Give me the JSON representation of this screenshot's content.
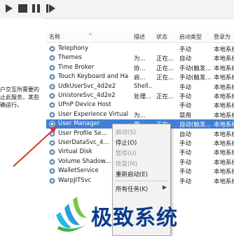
{
  "toolbar": {
    "buttons": [
      {
        "name": "start-icon"
      },
      {
        "name": "stop-icon"
      },
      {
        "name": "pause-icon"
      },
      {
        "name": "resume-icon"
      }
    ]
  },
  "left_pane": {
    "description_lines": [
      "户交互所需要的",
      "止此服务，某些",
      "确运行。"
    ]
  },
  "columns": {
    "name": "名称",
    "description": "描述",
    "status": "状态",
    "startup_type": "启动类型",
    "logon_as": "登录为"
  },
  "services": [
    {
      "name": "Telephony",
      "description": "",
      "status": "",
      "startup": "手动",
      "logon": "本地系统"
    },
    {
      "name": "Themes",
      "description": "为...",
      "status": "正在...",
      "startup": "自动",
      "logon": "本地系统"
    },
    {
      "name": "Time Broker",
      "description": "协...",
      "status": "正在...",
      "startup": "手动(触发...",
      "logon": "本地系统"
    },
    {
      "name": "Touch Keyboard and Ha...",
      "description": "启...",
      "status": "正在...",
      "startup": "手动(触发...",
      "logon": "本地系统"
    },
    {
      "name": "UdkUserSvc_4d2e2",
      "description": "Shell...",
      "status": "",
      "startup": "手动",
      "logon": "本地系统"
    },
    {
      "name": "UnistoreSvc_4d2e2",
      "description": "处理...",
      "status": "正在...",
      "startup": "手动",
      "logon": "本地系统"
    },
    {
      "name": "UPnP Device Host",
      "description": "",
      "status": "",
      "startup": "手动",
      "logon": "本地系统"
    },
    {
      "name": "User Experience Virtualiz...",
      "description": "为...",
      "status": "",
      "startup": "禁用",
      "logon": "本地系统"
    },
    {
      "name": "User Manager",
      "description": "用...",
      "status": "正在...",
      "startup": "自动(触发...",
      "logon": "本地系统",
      "selected": true
    },
    {
      "name": "User Profile Se...",
      "description": "",
      "status": "",
      "startup": "自动",
      "logon": "本地系统"
    },
    {
      "name": "UserDataSvc_4...",
      "description": "",
      "status": "",
      "startup": "手动",
      "logon": "本地系统"
    },
    {
      "name": "Virtual Disk",
      "description": "",
      "status": "",
      "startup": "手动",
      "logon": "本地系统"
    },
    {
      "name": "Volume Shadow...",
      "description": "",
      "status": "",
      "startup": "手动",
      "logon": "本地系统"
    },
    {
      "name": "WalletService",
      "description": "",
      "status": "",
      "startup": "手动",
      "logon": "本地系统"
    },
    {
      "name": "WarpJITSvc",
      "description": "",
      "status": "",
      "startup": "手动",
      "logon": "本地系统"
    }
  ],
  "context_menu": {
    "items": [
      {
        "label": "启动(S)",
        "disabled": true
      },
      {
        "label": "停止(O)",
        "disabled": false
      },
      {
        "label": "暂停(U)",
        "disabled": true
      },
      {
        "label": "恢复(M)",
        "disabled": true
      },
      {
        "label": "重新启动(E)",
        "disabled": false
      },
      {
        "label": "所有任务(K)",
        "disabled": false,
        "submenu": "▶"
      }
    ]
  },
  "watermark": {
    "text": "极致系统",
    "color": "#0c3b8a"
  },
  "colors": {
    "selection": "#3f7fd6",
    "annotation_arrow": "#d23a2f"
  }
}
